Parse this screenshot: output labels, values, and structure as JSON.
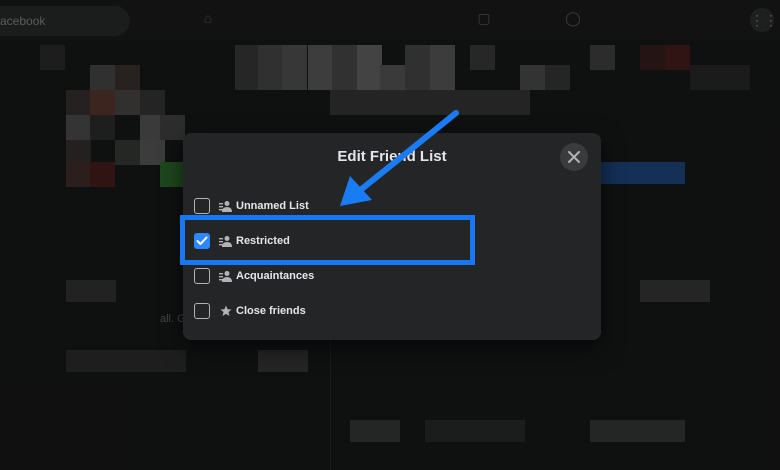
{
  "topbar": {
    "search_text": "acebook",
    "grid_icon": "grid-icon"
  },
  "modal": {
    "title": "Edit Friend List",
    "close_icon": "close-icon",
    "lists": [
      {
        "label": "Unnamed List",
        "checked": false,
        "icon": "people-icon"
      },
      {
        "label": "Restricted",
        "checked": true,
        "icon": "people-icon"
      },
      {
        "label": "Acquaintances",
        "checked": false,
        "icon": "people-icon"
      },
      {
        "label": "Close friends",
        "checked": false,
        "icon": "star-icon"
      }
    ]
  },
  "background_text": {
    "left_fragment": "all. G"
  },
  "colors": {
    "accent": "#1877f2",
    "checkbox_checked": "#2d88ff",
    "modal_bg": "#242526",
    "page_bg": "#18191a"
  }
}
